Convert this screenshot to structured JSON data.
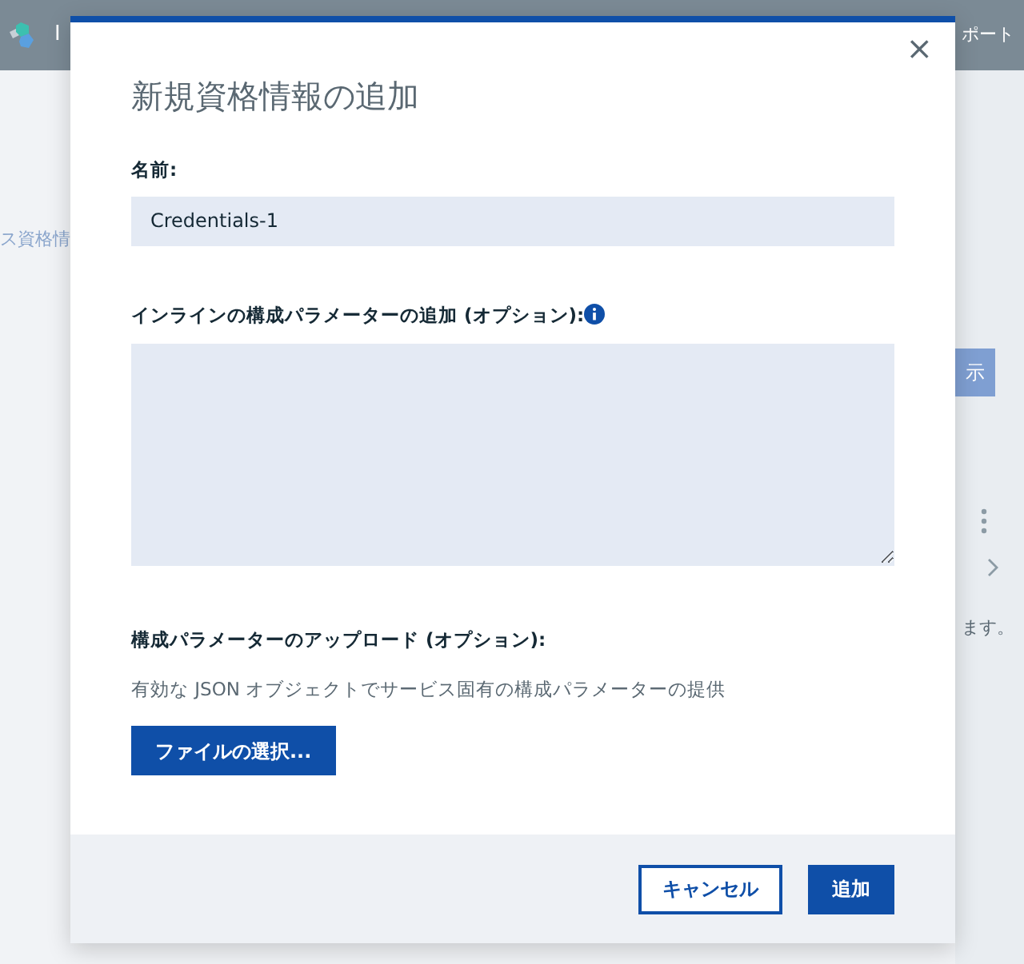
{
  "background": {
    "header": {
      "brand": "I",
      "link": "ポート"
    },
    "sidebar_item": "ス資格情",
    "action_button": "示",
    "note": "ます。"
  },
  "modal": {
    "title": "新規資格情報の追加",
    "close": "×",
    "fields": [
      {
        "kind": "input",
        "label": "名前:",
        "value": "Credentials-1"
      },
      {
        "kind": "textarea",
        "label": "インラインの構成パラメーターの追加 (オプション):",
        "info": true
      }
    ],
    "upload": {
      "label": "構成パラメーターのアップロード (オプション):",
      "description": "有効な JSON オブジェクトでサービス固有の構成パラメーターの提供",
      "button": "ファイルの選択..."
    },
    "buttons": [
      {
        "label": "キャンセル",
        "kind": "secondary"
      },
      {
        "label": "追加",
        "kind": "primary"
      }
    ]
  }
}
